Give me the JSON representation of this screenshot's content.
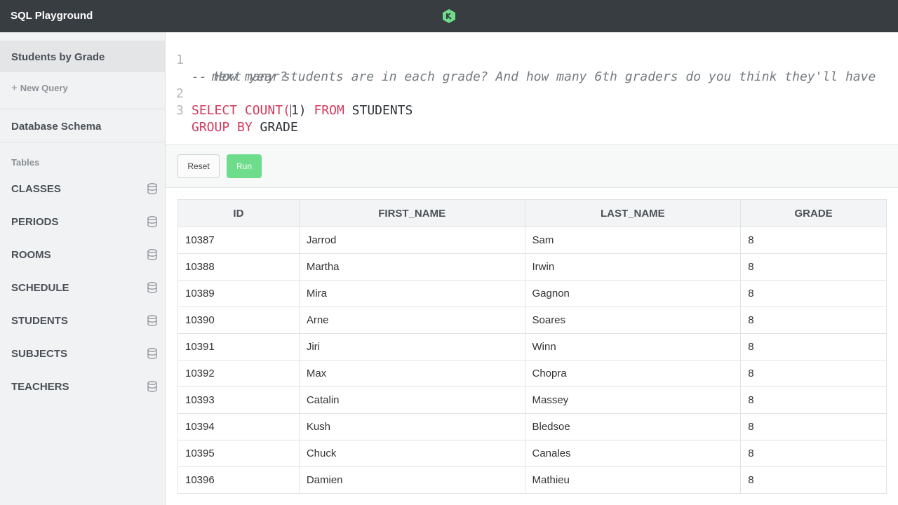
{
  "app": {
    "title": "SQL Playground",
    "logo_icon": "treehouse-logo-icon",
    "accent": "#6ddc8b"
  },
  "sidebar": {
    "active_query": "Students by Grade",
    "new_query_label": "New Query",
    "schema_title": "Database Schema",
    "tables_label": "Tables",
    "tables": [
      "CLASSES",
      "PERIODS",
      "ROOMS",
      "SCHEDULE",
      "STUDENTS",
      "SUBJECTS",
      "TEACHERS"
    ]
  },
  "editor": {
    "line_numbers": [
      "1",
      "2",
      "3"
    ],
    "comment_line_1": "-- How many students are in each grade? And how many 6th graders do you think they'll have",
    "comment_line_2": "next year?",
    "select_kw": "SELECT",
    "count_kw": "COUNT(",
    "count_arg": "1",
    "count_close": ")",
    "from_kw": "FROM",
    "table_name": "STUDENTS",
    "group_kw": "GROUP BY",
    "group_col": "GRADE"
  },
  "toolbar": {
    "reset_label": "Reset",
    "run_label": "Run"
  },
  "results": {
    "columns": [
      "ID",
      "FIRST_NAME",
      "LAST_NAME",
      "GRADE"
    ],
    "rows": [
      [
        "10387",
        "Jarrod",
        "Sam",
        "8"
      ],
      [
        "10388",
        "Martha",
        "Irwin",
        "8"
      ],
      [
        "10389",
        "Mira",
        "Gagnon",
        "8"
      ],
      [
        "10390",
        "Arne",
        "Soares",
        "8"
      ],
      [
        "10391",
        "Jiri",
        "Winn",
        "8"
      ],
      [
        "10392",
        "Max",
        "Chopra",
        "8"
      ],
      [
        "10393",
        "Catalin",
        "Massey",
        "8"
      ],
      [
        "10394",
        "Kush",
        "Bledsoe",
        "8"
      ],
      [
        "10395",
        "Chuck",
        "Canales",
        "8"
      ],
      [
        "10396",
        "Damien",
        "Mathieu",
        "8"
      ]
    ]
  }
}
